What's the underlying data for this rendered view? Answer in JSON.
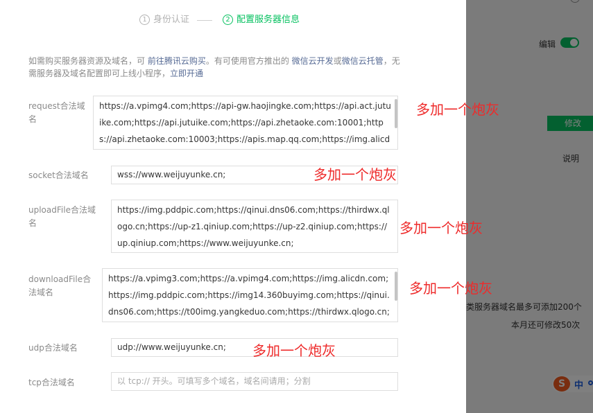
{
  "background": {
    "edit_label": "编辑",
    "modify_label": "修改",
    "desc_label": "说明",
    "info_line1": "类服务器域名最多可添加200个",
    "info_line2": "本月还可修改50次",
    "ime_label": "中"
  },
  "steps": [
    {
      "num": "1",
      "label": "身份认证",
      "state": "done"
    },
    {
      "num": "2",
      "label": "配置服务器信息",
      "state": "current"
    }
  ],
  "notice": {
    "part1": "如需购买服务器资源及域名，可 ",
    "link1": "前往腾讯云购买",
    "part2": "。有可使用官方推出的 ",
    "link2": "微信云开发",
    "part3": "或",
    "link3": "微信云托管",
    "part4": "，无需服务器及域名配置即可上线小程序，",
    "link4": "立即开通"
  },
  "fields": {
    "request": {
      "label": "request合法域名",
      "value": "https://a.vpimg4.com;https://api-gw.haojingke.com;https://api.act.jutuike.com;https://api.jutuike.com;https://api.zhetaoke.com:10001;https://api.zhetaoke.com:10003;https://apis.map.qq.com;https://img.alicdn.com;htt"
    },
    "socket": {
      "label": "socket合法域名",
      "value": "wss://www.weijuyunke.cn;"
    },
    "uploadFile": {
      "label": "uploadFile合法域名",
      "value": "https://img.pddpic.com;https://qinui.dns06.com;https://thirdwx.qlogo.cn;https://up-z1.qiniup.com;https://up-z2.qiniup.com;https://up.qiniup.com;https://www.weijuyunke.cn;"
    },
    "downloadFile": {
      "label": "downloadFile合法域名",
      "value": "https://a.vpimg3.com;https://a.vpimg4.com;https://img.alicdn.com;https://img.pddpic.com;https://img14.360buyimg.com;https://qinui.dns06.com;https://t00img.yangkeduo.com;https://thirdwx.qlogo.cn;https://"
    },
    "udp": {
      "label": "udp合法域名",
      "value": "udp://www.weijuyunke.cn;"
    },
    "tcp": {
      "label": "tcp合法域名",
      "placeholder": "以 tcp:// 开头。可填写多个域名，域名间请用；分割"
    }
  },
  "annotation_text": "多加一个炮灰",
  "colors": {
    "accent_green": "#07c160",
    "link_blue": "#576b95",
    "annotation_red": "#ee2a2a"
  }
}
